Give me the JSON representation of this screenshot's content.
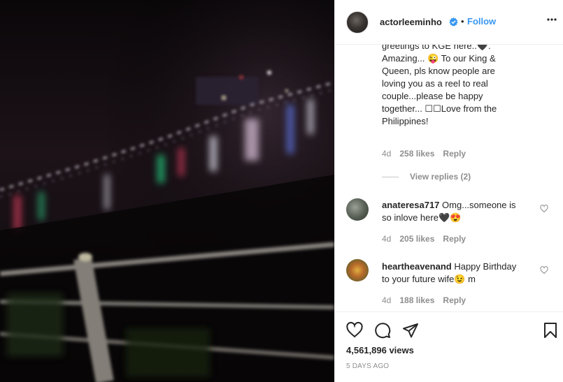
{
  "post": {
    "username": "actorleeminho",
    "separator": "•",
    "follow_label": "Follow"
  },
  "comments": {
    "first": {
      "text_lines": [
        "greetings to KGE here..🖤.",
        "Amazing... 😜 To our King &",
        "Queen, pls know people are",
        "loving you as a reel to real",
        "couple...please be happy",
        "together... ☐☐Love from the",
        "Philippines!"
      ],
      "time": "4d",
      "likes": "258 likes",
      "reply": "Reply",
      "view_replies": "View replies (2)"
    },
    "second": {
      "username": "anateresa717",
      "text_a": "Omg...someone is",
      "text_b": "so inlove here🖤😍",
      "time": "4d",
      "likes": "205 likes",
      "reply": "Reply"
    },
    "third": {
      "username": "heartheavenand",
      "text_a": "Happy Birthday",
      "text_b": "to your future wife😉 m",
      "time": "4d",
      "likes": "188 likes",
      "reply": "Reply"
    }
  },
  "stats": {
    "views": "4,561,896 views",
    "date": "5 DAYS AGO"
  },
  "icons": {
    "verified": "verified-badge-icon",
    "more": "more-options-icon",
    "like": "heart-icon",
    "comment": "comment-icon",
    "share": "paper-plane-icon",
    "save": "bookmark-icon"
  },
  "colors": {
    "link": "#3897f0",
    "verified": "#3897f0",
    "text": "#262626",
    "muted": "#8e8e8e"
  }
}
